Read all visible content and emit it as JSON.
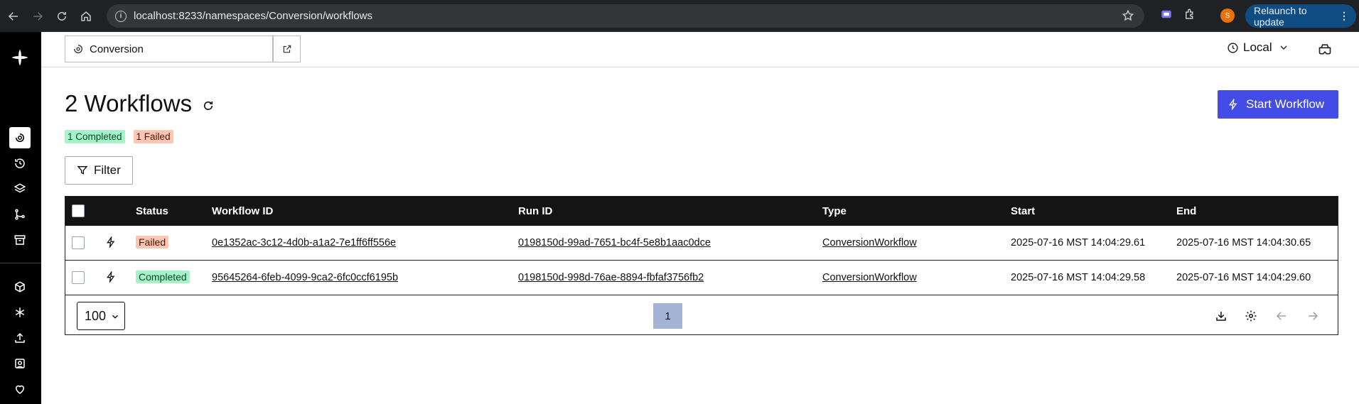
{
  "browser": {
    "url": "localhost:8233/namespaces/Conversion/workflows",
    "relaunch_label": "Relaunch to update",
    "profile_initial": "S"
  },
  "namespace": {
    "name": "Conversion"
  },
  "timezone": {
    "label": "Local"
  },
  "page": {
    "title": "2 Workflows",
    "start_button": "Start Workflow",
    "filter_button": "Filter",
    "badges": {
      "completed": "1 Completed",
      "failed": "1 Failed"
    }
  },
  "table": {
    "headers": {
      "status": "Status",
      "workflow_id": "Workflow ID",
      "run_id": "Run ID",
      "type": "Type",
      "start": "Start",
      "end": "End"
    },
    "rows": [
      {
        "status": "Failed",
        "workflow_id": "0e1352ac-3c12-4d0b-a1a2-7e1ff6ff556e",
        "run_id": "0198150d-99ad-7651-bc4f-5e8b1aac0dce",
        "type": "ConversionWorkflow",
        "start": "2025-07-16 MST 14:04:29.61",
        "end": "2025-07-16 MST 14:04:30.65"
      },
      {
        "status": "Completed",
        "workflow_id": "95645264-6feb-4099-9ca2-6fc0ccf6195b",
        "run_id": "0198150d-998d-76ae-8894-fbfaf3756fb2",
        "type": "ConversionWorkflow",
        "start": "2025-07-16 MST 14:04:29.58",
        "end": "2025-07-16 MST 14:04:29.60"
      }
    ]
  },
  "pagination": {
    "page_size": "100",
    "current_page": "1"
  },
  "colors": {
    "accent": "#444ce7",
    "completed_bg": "#a6f3c9",
    "failed_bg": "#fcc6b5",
    "header_bg": "#141414",
    "sidebar_bg": "#000000"
  }
}
